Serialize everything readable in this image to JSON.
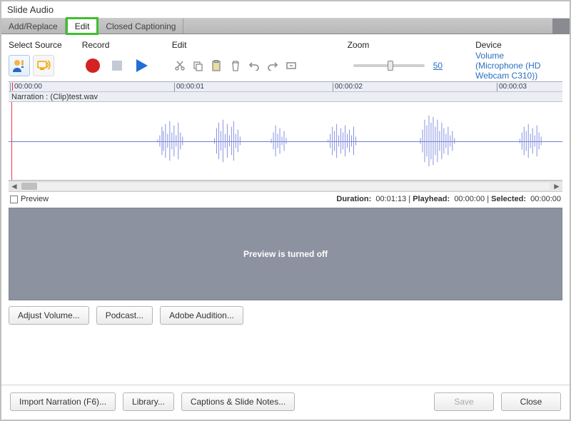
{
  "window_title": "Slide Audio",
  "tabs": {
    "add_replace": "Add/Replace",
    "edit": "Edit",
    "cc": "Closed Captioning"
  },
  "toolbar": {
    "select_source_label": "Select Source",
    "record_label": "Record",
    "edit_label": "Edit",
    "zoom_label": "Zoom",
    "device_label": "Device",
    "zoom_value": "50",
    "device_link": "Volume (Microphone (HD Webcam C310))"
  },
  "timeline": {
    "ticks": [
      "00:00:00",
      "00:00:01",
      "00:00:02",
      "00:00:03"
    ],
    "track_label": "Narration : (Clip)test.wav"
  },
  "status": {
    "preview_label": "Preview",
    "duration_label": "Duration:",
    "duration_value": "00:01:13",
    "playhead_label": "Playhead:",
    "playhead_value": "00:00:00",
    "selected_label": "Selected:",
    "selected_value": "00:00:00"
  },
  "preview_message": "Preview is turned off",
  "buttons": {
    "adjust_volume": "Adjust Volume...",
    "podcast": "Podcast...",
    "adobe_audition": "Adobe Audition...",
    "import_narration": "Import Narration (F6)...",
    "library": "Library...",
    "captions_notes": "Captions & Slide Notes...",
    "save": "Save",
    "close": "Close"
  }
}
